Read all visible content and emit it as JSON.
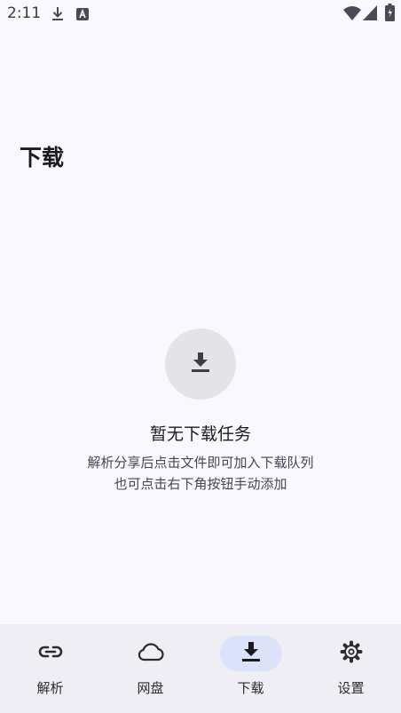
{
  "status_bar": {
    "time": "2:11",
    "icons": [
      "download-icon",
      "a-icon",
      "wifi-icon",
      "signal-icon",
      "battery-icon"
    ]
  },
  "page": {
    "title": "下载"
  },
  "empty_state": {
    "icon": "download-icon",
    "title": "暂无下载任务",
    "description_line1": "解析分享后点击文件即可加入下载队列",
    "description_line2": "也可点击右下角按钮手动添加"
  },
  "bottom_nav": {
    "active_index": 2,
    "items": [
      {
        "label": "解析",
        "icon": "link-icon"
      },
      {
        "label": "网盘",
        "icon": "cloud-icon"
      },
      {
        "label": "下载",
        "icon": "download-icon"
      },
      {
        "label": "设置",
        "icon": "gear-icon"
      }
    ]
  },
  "colors": {
    "background": "#f9f8fe",
    "nav_background": "#efeef4",
    "active_indicator": "#dce2f9",
    "empty_icon_circle": "#e4e3e8"
  }
}
